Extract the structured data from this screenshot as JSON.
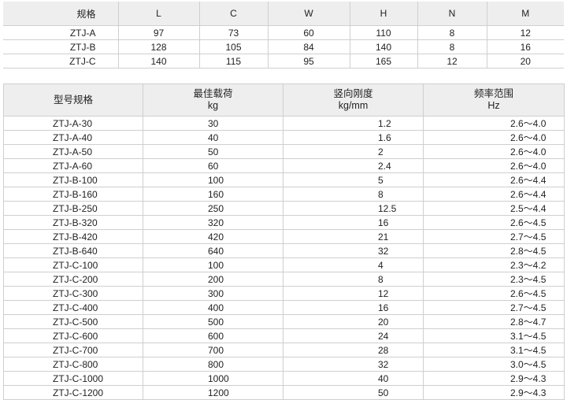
{
  "dimension_table": {
    "headers": [
      "规格",
      "L",
      "C",
      "W",
      "H",
      "N",
      "M"
    ],
    "rows": [
      [
        "ZTJ-A",
        "97",
        "73",
        "60",
        "110",
        "8",
        "12"
      ],
      [
        "ZTJ-B",
        "128",
        "105",
        "84",
        "140",
        "8",
        "16"
      ],
      [
        "ZTJ-C",
        "140",
        "115",
        "95",
        "165",
        "12",
        "20"
      ]
    ]
  },
  "spec_table": {
    "headers": [
      {
        "line1": "型号规格",
        "line2": ""
      },
      {
        "line1": "最佳载荷",
        "line2": "kg"
      },
      {
        "line1": "竖向刚度",
        "line2": "kg/mm"
      },
      {
        "line1": "频率范围",
        "line2": "Hz"
      }
    ],
    "rows": [
      [
        "ZTJ-A-30",
        "30",
        "1.2",
        "2.6～4.0"
      ],
      [
        "ZTJ-A-40",
        "40",
        "1.6",
        "2.6～4.0"
      ],
      [
        "ZTJ-A-50",
        "50",
        "2",
        "2.6～4.0"
      ],
      [
        "ZTJ-A-60",
        "60",
        "2.4",
        "2.6～4.0"
      ],
      [
        "ZTJ-B-100",
        "100",
        "5",
        "2.6～4.4"
      ],
      [
        "ZTJ-B-160",
        "160",
        "8",
        "2.6～4.4"
      ],
      [
        "ZTJ-B-250",
        "250",
        "12.5",
        "2.5～4.4"
      ],
      [
        "ZTJ-B-320",
        "320",
        "16",
        "2.6～4.5"
      ],
      [
        "ZTJ-B-420",
        "420",
        "21",
        "2.7～4.5"
      ],
      [
        "ZTJ-B-640",
        "640",
        "32",
        "2.8～4.5"
      ],
      [
        "ZTJ-C-100",
        "100",
        "4",
        "2.3～4.2"
      ],
      [
        "ZTJ-C-200",
        "200",
        "8",
        "2.3～4.5"
      ],
      [
        "ZTJ-C-300",
        "300",
        "12",
        "2.6～4.5"
      ],
      [
        "ZTJ-C-400",
        "400",
        "16",
        "2.7～4.5"
      ],
      [
        "ZTJ-C-500",
        "500",
        "20",
        "2.8～4.7"
      ],
      [
        "ZTJ-C-600",
        "600",
        "24",
        "3.1～4.5"
      ],
      [
        "ZTJ-C-700",
        "700",
        "28",
        "3.1～4.5"
      ],
      [
        "ZTJ-C-800",
        "800",
        "32",
        "3.0～4.5"
      ],
      [
        "ZTJ-C-1000",
        "1000",
        "40",
        "2.9～4.3"
      ],
      [
        "ZTJ-C-1200",
        "1200",
        "50",
        "2.9～4.3"
      ]
    ]
  }
}
